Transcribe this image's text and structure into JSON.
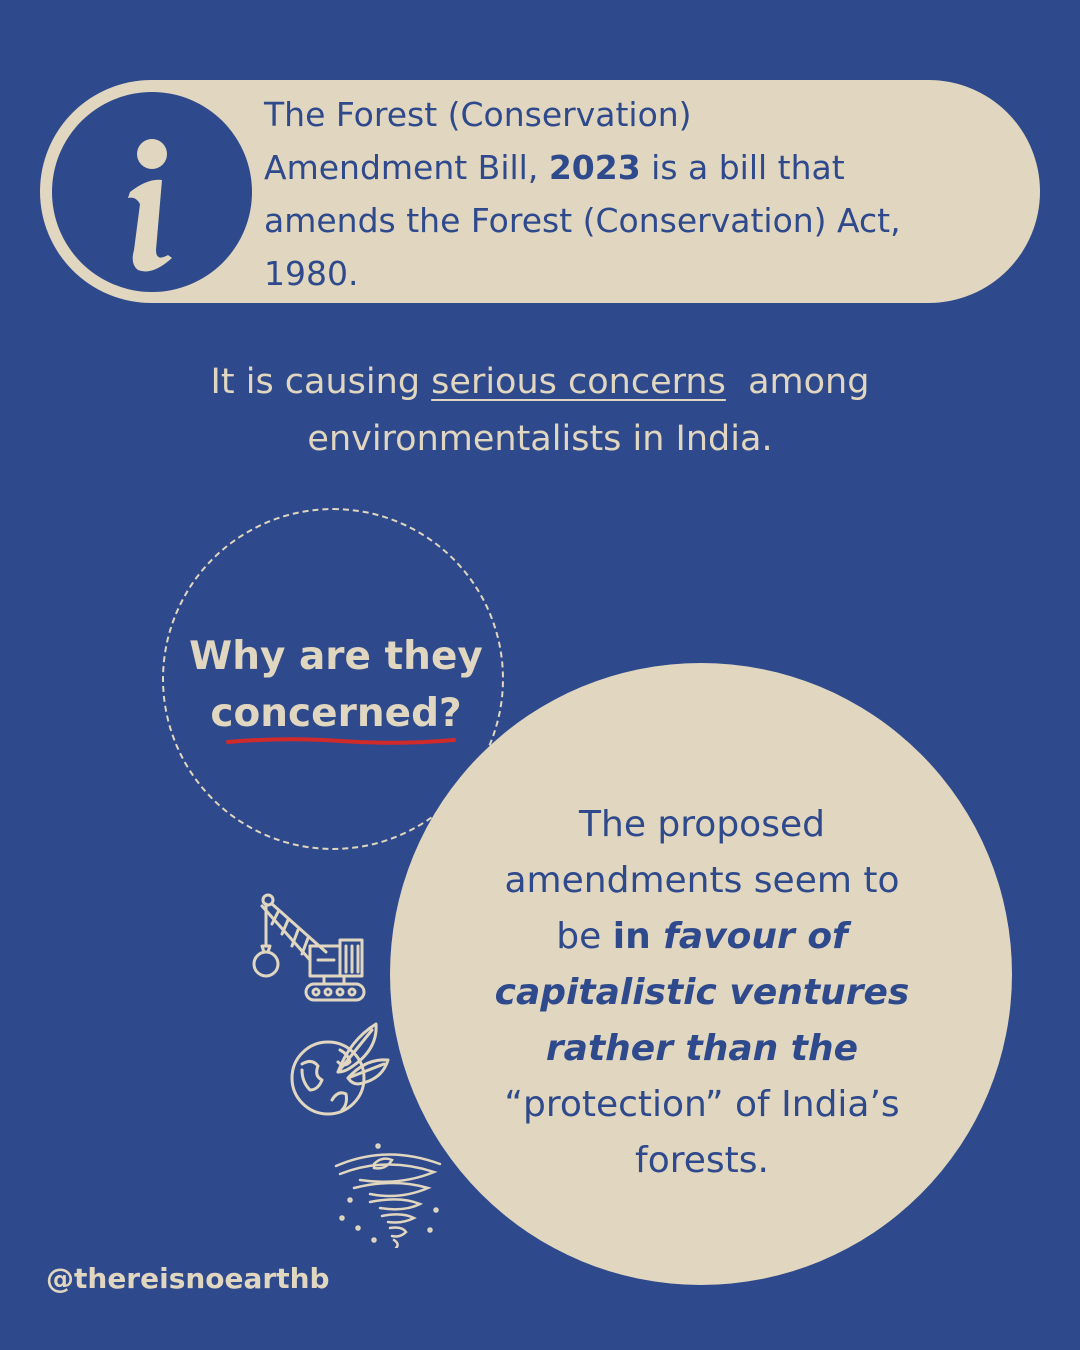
{
  "info_box": {
    "icon": "info-icon",
    "line1": "The Forest (Conservation)",
    "line2_pre": "Amendment Bill, ",
    "line2_bold": "2023",
    "line2_post": " is a bill that",
    "line3": "amends the Forest (Conservation) Act,",
    "line4": "1980."
  },
  "concern": {
    "pre": "It is causing ",
    "underlined": "serious concerns",
    "post": "  among",
    "line2": "environmentalists in India."
  },
  "question": {
    "line1": "Why are they",
    "line2": "concerned?"
  },
  "answer": {
    "line1": "The proposed",
    "line2": "amendments seem to",
    "line3_pre": "be ",
    "line3_bold": "in ",
    "line3_italic": "favour of",
    "line4": "capitalistic ventures",
    "line5": "rather than the",
    "line6": "“protection” of India’s",
    "line7": "forests."
  },
  "icons": [
    "crane-wrecking-ball-icon",
    "earth-leaves-icon",
    "tornado-icon"
  ],
  "handle": "@thereisnoearthb",
  "colors": {
    "background": "#2e4a8c",
    "cream": "#e1d6bf",
    "accent_red": "#d02a2a"
  }
}
